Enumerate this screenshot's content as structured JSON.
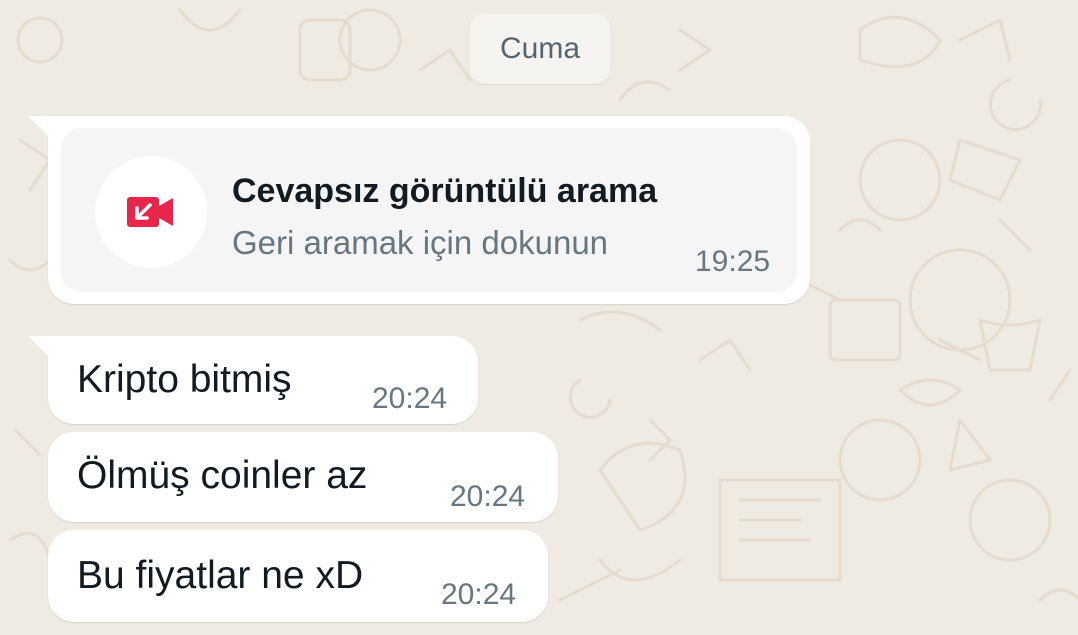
{
  "chat": {
    "date_separator": "Cuma",
    "missed_call": {
      "title": "Cevapsız görüntülü arama",
      "subtitle": "Geri aramak için dokunun",
      "time": "19:25",
      "icon": "missed-video-call-icon",
      "icon_color": "#e8254a"
    },
    "messages": [
      {
        "text": "Kripto bitmiş",
        "time": "20:24"
      },
      {
        "text": "Ölmüş coinler az",
        "time": "20:24"
      },
      {
        "text": "Bu fiyatlar ne xD",
        "time": "20:24"
      }
    ]
  },
  "colors": {
    "background": "#efeae2",
    "bubble": "#ffffff",
    "meta_text": "#667781",
    "primary_text": "#111b21"
  }
}
